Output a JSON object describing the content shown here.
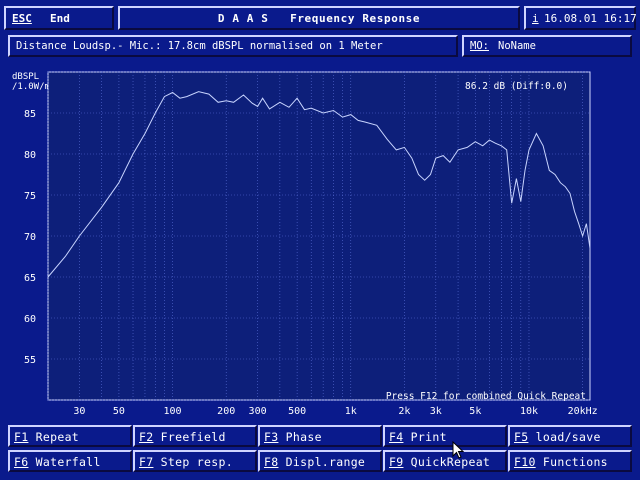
{
  "topbar": {
    "esc_key": "ESC",
    "esc_label": "End",
    "title": "D A A S   Frequency Response",
    "info_key": "i",
    "datetime": "16.08.01 16:17"
  },
  "infobar": {
    "description": "Distance Loudsp.- Mic.: 17.8cm dBSPL normalised on 1 Meter",
    "mo_label": "MO:",
    "mo_value": "NoName"
  },
  "colors": {
    "background": "#0a1a8c",
    "plot_bg": "#0d1f7a",
    "grid": "#5a6fd8",
    "curve": "#c8d4ff",
    "text": "#ffffff"
  },
  "chart_data": {
    "type": "line",
    "ylabel": "dBSPL /1.0W/m",
    "readout": "86.2 dB (Diff:0.0)",
    "hint": "Press F12 for combined Quick Repeat",
    "x_scale": "log",
    "xlim": [
      20,
      22000
    ],
    "ylim": [
      50,
      90
    ],
    "grid": true,
    "x_ticks": [
      {
        "v": 30,
        "label": "30"
      },
      {
        "v": 50,
        "label": "50"
      },
      {
        "v": 100,
        "label": "100"
      },
      {
        "v": 200,
        "label": "200"
      },
      {
        "v": 300,
        "label": "300"
      },
      {
        "v": 500,
        "label": "500"
      },
      {
        "v": 1000,
        "label": "1k"
      },
      {
        "v": 2000,
        "label": "2k"
      },
      {
        "v": 3000,
        "label": "3k"
      },
      {
        "v": 5000,
        "label": "5k"
      },
      {
        "v": 10000,
        "label": "10k"
      },
      {
        "v": 20000,
        "label": "20kHz"
      }
    ],
    "y_ticks": [
      85,
      80,
      75,
      70,
      65,
      60,
      55
    ],
    "series": [
      {
        "x": [
          20,
          25,
          30,
          40,
          50,
          60,
          70,
          80,
          90,
          100,
          110,
          120,
          140,
          160,
          180,
          200,
          220,
          250,
          280,
          300,
          320,
          350,
          400,
          450,
          500,
          550,
          600,
          700,
          800,
          900,
          1000,
          1100,
          1200,
          1400,
          1600,
          1800,
          2000,
          2200,
          2400,
          2600,
          2800,
          3000,
          3300,
          3600,
          4000,
          4500,
          5000,
          5500,
          6000,
          6500,
          7000,
          7500,
          8000,
          8500,
          9000,
          9500,
          10000,
          11000,
          12000,
          13000,
          14000,
          15000,
          16000,
          17000,
          18000,
          19000,
          20000,
          21000,
          22000
        ],
        "y": [
          65,
          67.5,
          70,
          73.5,
          76.5,
          80,
          82.5,
          85,
          87,
          87.5,
          86.8,
          87,
          87.6,
          87.3,
          86.3,
          86.5,
          86.3,
          87.2,
          86.2,
          85.8,
          86.8,
          85.5,
          86.3,
          85.7,
          86.8,
          85.4,
          85.6,
          85,
          85.3,
          84.5,
          84.8,
          84.1,
          83.9,
          83.5,
          81.8,
          80.5,
          80.8,
          79.5,
          77.5,
          76.8,
          77.5,
          79.5,
          79.8,
          79,
          80.5,
          80.8,
          81.5,
          81,
          81.7,
          81.3,
          81,
          80.5,
          74,
          77,
          74.2,
          78,
          80.5,
          82.5,
          81,
          78,
          77.5,
          76.5,
          76,
          75.2,
          73,
          71.5,
          70,
          71.5,
          68.5
        ]
      }
    ]
  },
  "fkeys": [
    {
      "key": "F1",
      "label": "Repeat"
    },
    {
      "key": "F2",
      "label": "Freefield"
    },
    {
      "key": "F3",
      "label": "Phase"
    },
    {
      "key": "F4",
      "label": "Print"
    },
    {
      "key": "F5",
      "label": "load/save"
    },
    {
      "key": "F6",
      "label": "Waterfall"
    },
    {
      "key": "F7",
      "label": "Step resp."
    },
    {
      "key": "F8",
      "label": "Displ.range"
    },
    {
      "key": "F9",
      "label": "QuickRepeat"
    },
    {
      "key": "F10",
      "label": "Functions"
    }
  ]
}
